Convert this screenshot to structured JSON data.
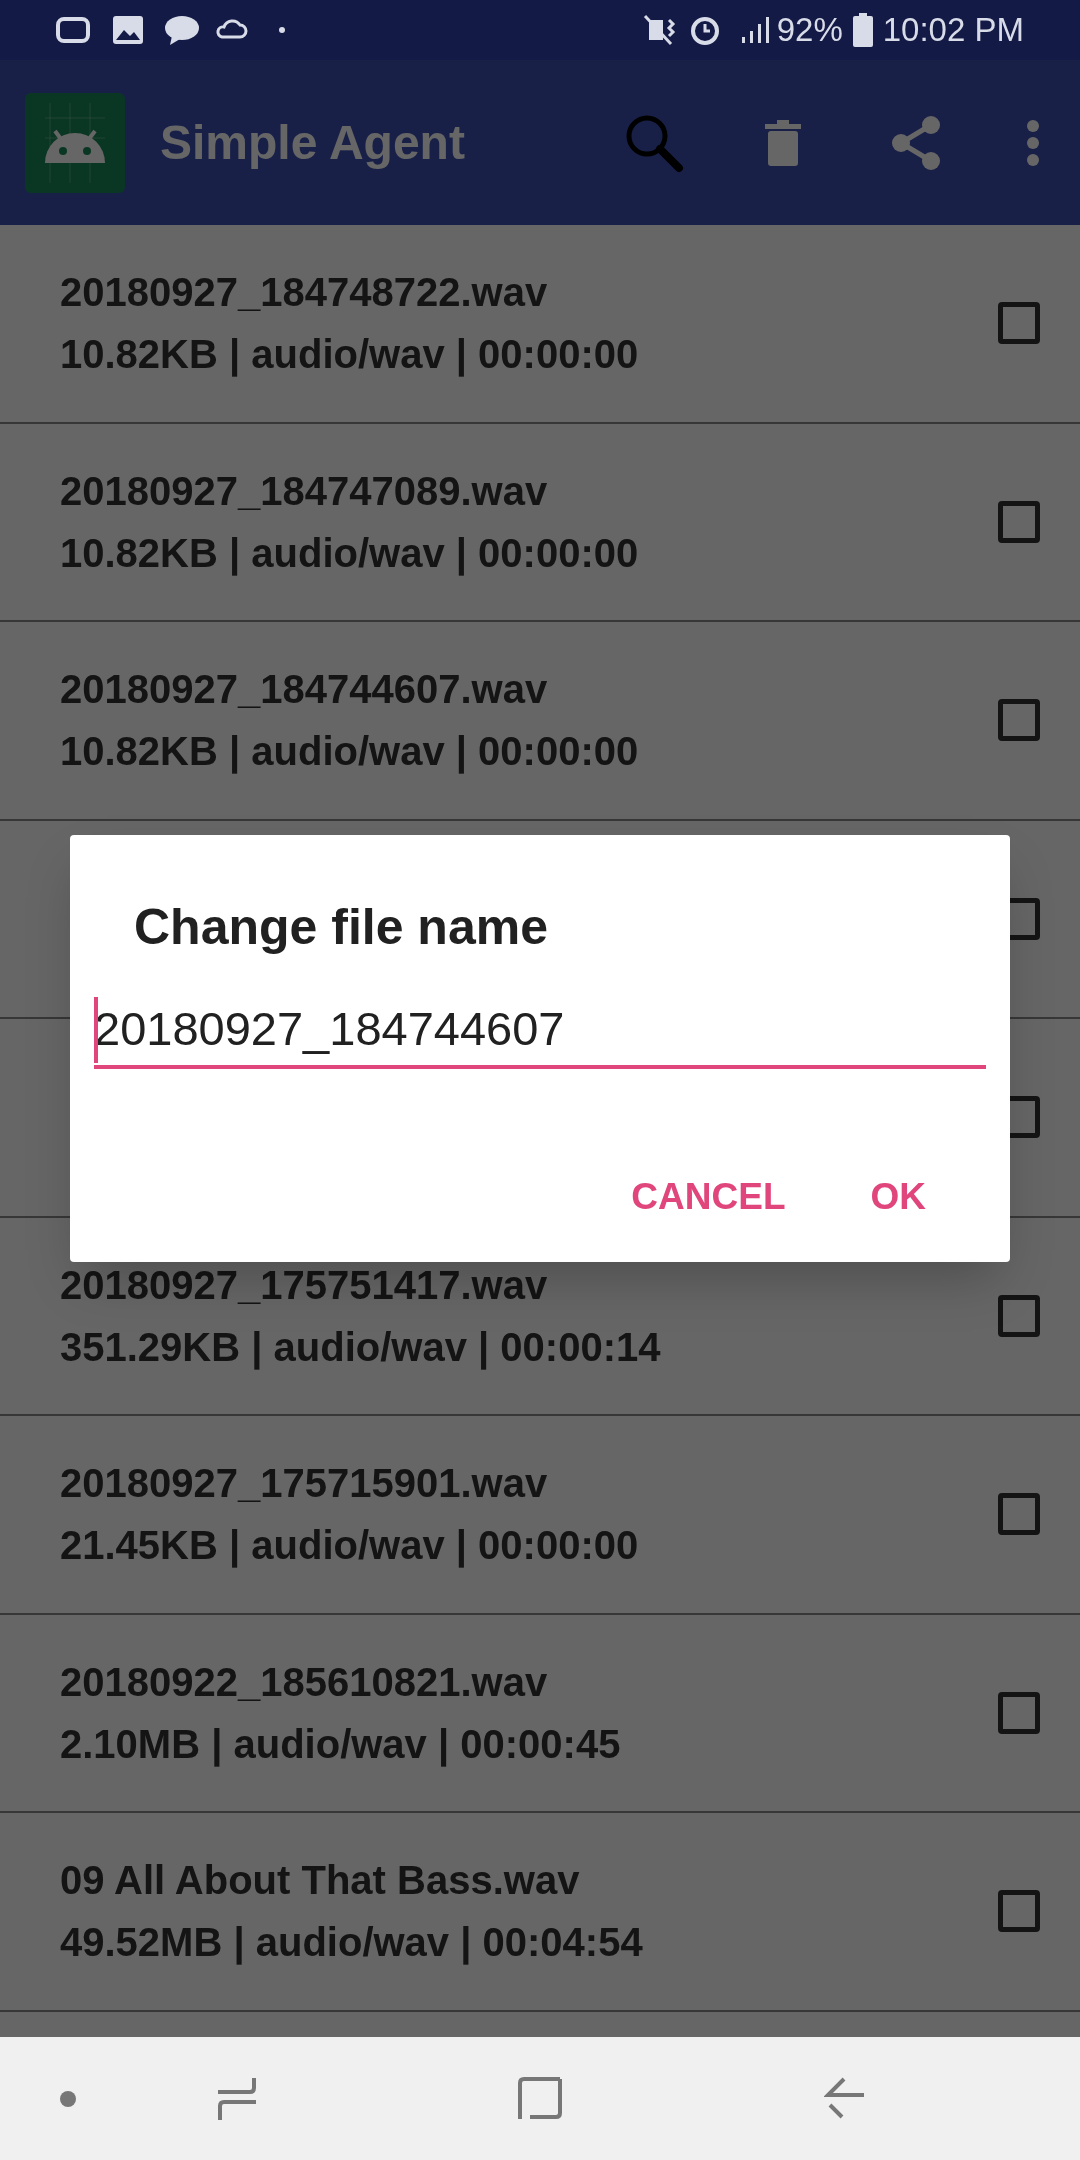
{
  "status_bar": {
    "battery": "92%",
    "time": "10:02 PM"
  },
  "app_bar": {
    "title": "Simple Agent"
  },
  "files": [
    {
      "name": "20180927_184748722.wav",
      "details": "10.82KB | audio/wav | 00:00:00",
      "checked": false
    },
    {
      "name": "20180927_184747089.wav",
      "details": "10.82KB | audio/wav | 00:00:00",
      "checked": false
    },
    {
      "name": "20180927_184744607.wav",
      "details": "10.82KB | audio/wav | 00:00:00",
      "checked": false
    },
    {
      "checked": false
    },
    {
      "checked": false
    },
    {
      "name": "20180927_175751417.wav",
      "details": "351.29KB | audio/wav | 00:00:14",
      "checked": false
    },
    {
      "name": "20180927_175715901.wav",
      "details": "21.45KB | audio/wav | 00:00:00",
      "checked": false
    },
    {
      "name": "20180922_185610821.wav",
      "details": "2.10MB | audio/wav | 00:00:45",
      "checked": false
    },
    {
      "name": "09 All About That Bass.wav",
      "details": "49.52MB | audio/wav | 00:04:54",
      "checked": false
    }
  ],
  "dialog": {
    "title": "Change file name",
    "value": "20180927_184744607",
    "buttons": [
      "CANCEL",
      "OK"
    ]
  }
}
